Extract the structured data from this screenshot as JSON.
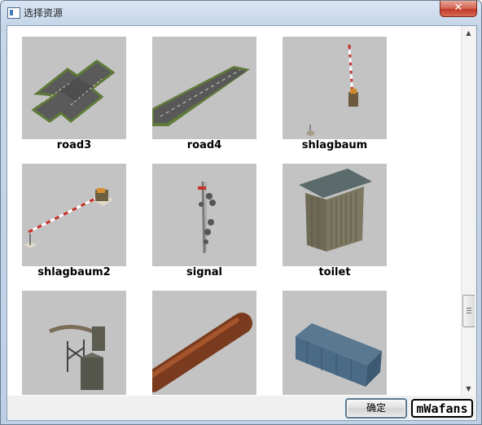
{
  "window": {
    "title": "选择资源",
    "close_glyph": "✕"
  },
  "assets": [
    {
      "name": "road3",
      "icon": "crossroad-icon"
    },
    {
      "name": "road4",
      "icon": "road-strip-icon"
    },
    {
      "name": "shlagbaum",
      "icon": "barrier-icon"
    },
    {
      "name": "shlagbaum2",
      "icon": "barrier-lowered-icon"
    },
    {
      "name": "signal",
      "icon": "signal-mast-icon"
    },
    {
      "name": "toilet",
      "icon": "toilet-booth-icon"
    },
    {
      "name": "",
      "icon": "water-crane-icon"
    },
    {
      "name": "",
      "icon": "log-pole-icon"
    },
    {
      "name": "",
      "icon": "wagon-icon"
    }
  ],
  "footer": {
    "ok_label": "确定",
    "logo_text": "mWafans"
  },
  "scrollbar": {
    "up_glyph": "▲",
    "down_glyph": "▼"
  }
}
